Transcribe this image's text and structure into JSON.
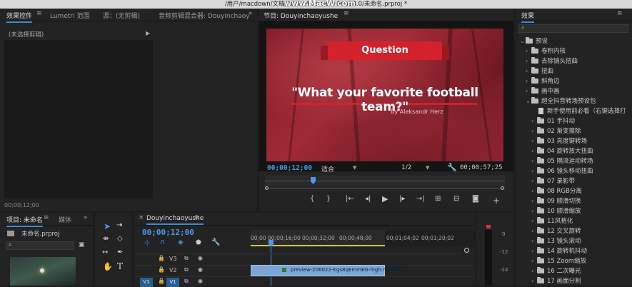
{
  "window_title": "/用户/macdown/文档/Adobe/Premiere Pro/13.0/未命名.prproj *",
  "watermark": "www.MacW.com",
  "source_panel": {
    "tabs": [
      "效果控件",
      "Lumetri 范围",
      "源：(无剪辑)",
      "音频剪辑混合器: Douyinchaoy"
    ],
    "no_clip": "(未选择剪辑)",
    "timecode": "00;00;12;00"
  },
  "program_monitor": {
    "title": "节目: Douyinchaoyushe",
    "timecode": "00;00;12;00",
    "fit_label": "适合",
    "resolution": "1/2",
    "duration": "00;00;57;25",
    "ribbon_text": "Question",
    "headline": "\"What your favorite football team?\"",
    "byline": "by Aleksandr Herz"
  },
  "project_panel": {
    "tab_title": "项目: 未命名",
    "tab_media": "媒体",
    "file_name": "未命名.prproj"
  },
  "timeline": {
    "sequence_tab": "Douyinchaoyushe",
    "timecode": "00;00;12;00",
    "ruler": [
      "00;00",
      "00;00;16;00",
      "00;00;32;00",
      "00;00;48;00",
      "00;01;04;02",
      "00;01;20;02"
    ],
    "tracks": [
      "V3",
      "V2",
      "V1"
    ],
    "clip_label": "preview-206022-Kgs8qEmmEG-high.mp4 [V]",
    "source_patch": "V1",
    "meter_labels": [
      "0",
      "-12",
      "-24"
    ]
  },
  "effects_panel": {
    "title": "效果",
    "search_placeholder": "",
    "items": [
      {
        "label": "预设",
        "level": 0,
        "expanded": true
      },
      {
        "label": "卷积内核",
        "level": 1
      },
      {
        "label": "去除镜头扭曲",
        "level": 1
      },
      {
        "label": "扭曲",
        "level": 1
      },
      {
        "label": "斜角边",
        "level": 1
      },
      {
        "label": "画中画",
        "level": 1
      },
      {
        "label": "超全抖音转场预设包",
        "level": 1,
        "expanded": true
      },
      {
        "label": "新手使用前必看（右键选择打",
        "level": 2,
        "doc": true
      },
      {
        "label": "01 手抖动",
        "level": 2
      },
      {
        "label": "02 渐变擦除",
        "level": 2
      },
      {
        "label": "03 亮度键转场",
        "level": 2
      },
      {
        "label": "04 旋转放大扭曲",
        "level": 2
      },
      {
        "label": "05 隔流运动转场",
        "level": 2
      },
      {
        "label": "06 镜头移动扭曲",
        "level": 2
      },
      {
        "label": "07 录影带",
        "level": 2
      },
      {
        "label": "08 RGB分离",
        "level": 2
      },
      {
        "label": "09 顺滑切换",
        "level": 2
      },
      {
        "label": "10 顺滑缩放",
        "level": 2
      },
      {
        "label": "11风格化",
        "level": 2
      },
      {
        "label": "12 交叉旋转",
        "level": 2
      },
      {
        "label": "13 镜头滚动",
        "level": 2
      },
      {
        "label": "14 旋转机抖动",
        "level": 2
      },
      {
        "label": "15 Zoom缩放",
        "level": 2
      },
      {
        "label": "16 二次曝光",
        "level": 2
      },
      {
        "label": "17 画面分割",
        "level": 2
      }
    ]
  },
  "colors": {
    "accent": "#3c8bd9",
    "timecode": "#4a9ae6",
    "clip": "#7aa6d6",
    "title_red": "#d4222c"
  }
}
